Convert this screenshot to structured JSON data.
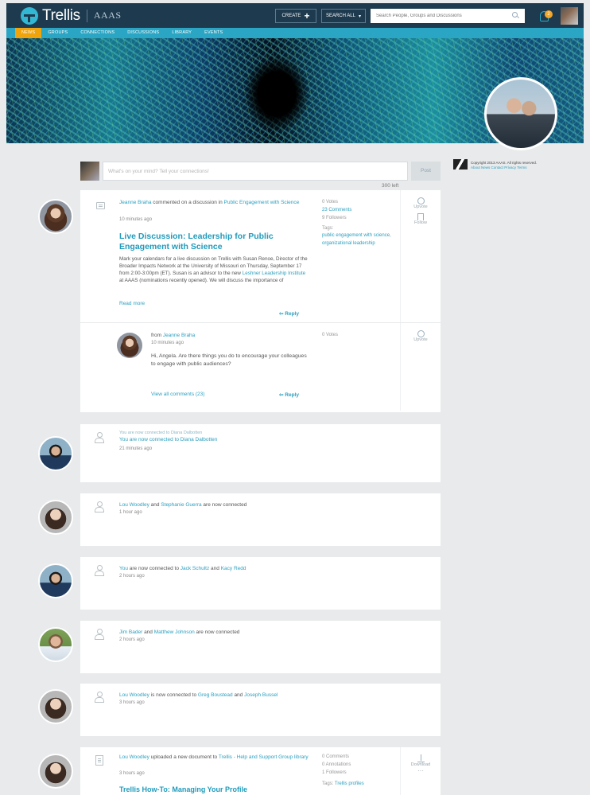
{
  "app": {
    "logo": "Trellis",
    "org": "AAAS"
  },
  "header": {
    "create_label": "CREATE",
    "search_all_label": "SEARCH ALL",
    "search_placeholder": "Search People, Groups and Discussions",
    "notification_count": "2"
  },
  "nav": [
    "NEWS",
    "GROUPS",
    "CONNECTIONS",
    "DISCUSSIONS",
    "LIBRARY",
    "EVENTS"
  ],
  "composer": {
    "placeholder": "What's on your mind? Tell your connections!",
    "post_label": "Post",
    "chars_left": "300 left"
  },
  "sidebar": {
    "copyright": "Copyright 2013 AAAS. All rights reserved.",
    "links": "About  News  Contact  Privacy  Terms"
  },
  "feed": {
    "discussion": {
      "actor": "Jeanne Braha",
      "action": " commented on a discussion in ",
      "group": "Public Engagement with Science",
      "time": "10 minutes ago",
      "title": "Live Discussion: Leadership for Public Engagement with Science",
      "body_1": "Mark your calendars for a live discussion on Trellis with Susan Renoe, Director of the Broader Impacts Network at the University of Missouri on Thursday, September 17 from 2:00-3:00pm (ET). Susan is an advisor to the new ",
      "body_link": "Leshner Leadership Institute",
      "body_2": " at AAAS (nominations recently opened). We will discuss the importance of",
      "read_more": "Read more",
      "reply": "Reply",
      "votes": "0 Votes",
      "comments": "23 Comments",
      "followers": "9 Followers",
      "tags_label": "Tags:",
      "tags": [
        "public engagement with science,",
        "organizational leadership"
      ],
      "upvote": "Upvote",
      "follow": "Follow",
      "comment": {
        "from_label": "from ",
        "from": "Jeanne Braha",
        "time": "10 minutes ago",
        "text": "Hi, Angela. Are there things you do to encourage your colleagues to engage with public audiences?",
        "view_all": "View all comments (23)",
        "reply": "Reply",
        "votes": "0 Votes",
        "upvote": "Upvote"
      }
    },
    "connections": [
      {
        "line1": "You are now connected to Diana Dalbotten",
        "line2_a": "You",
        "line2_b": " are now connected to ",
        "line2_c": "Diana Dalbotten",
        "time": "21 minutes ago"
      },
      {
        "a": "Lou Woodley",
        "mid": " and ",
        "b": "Stephanie Guerra",
        "end": " are now connected",
        "time": "1 hour ago"
      },
      {
        "a": "You",
        "mid": " are now connected to ",
        "b": "Jack Schultz",
        "mid2": " and ",
        "c": "Kacy Redd",
        "time": "2 hours ago"
      },
      {
        "a": "Jim Bader",
        "mid": " and ",
        "b": "Matthew Johnson",
        "end": " are now connected",
        "time": "2 hours ago"
      },
      {
        "a": "Lou Woodley",
        "mid": " is now connected to ",
        "b": "Greg Boustead",
        "mid2": " and ",
        "c": "Joseph Bussel",
        "time": "3 hours ago"
      }
    ],
    "document": {
      "actor": "Lou Woodley",
      "action": " uploaded a new document to ",
      "group": "Trellis - Help and Support",
      "group_suffix": " Group library",
      "time": "3 hours ago",
      "title": "Trellis How-To: Managing Your Profile",
      "comments": "0 Comments",
      "annotations": "0 Annotations",
      "followers": "1 Followers",
      "tags_label": "Tags:",
      "tag": "Trellis profiles",
      "download": "Download"
    }
  }
}
